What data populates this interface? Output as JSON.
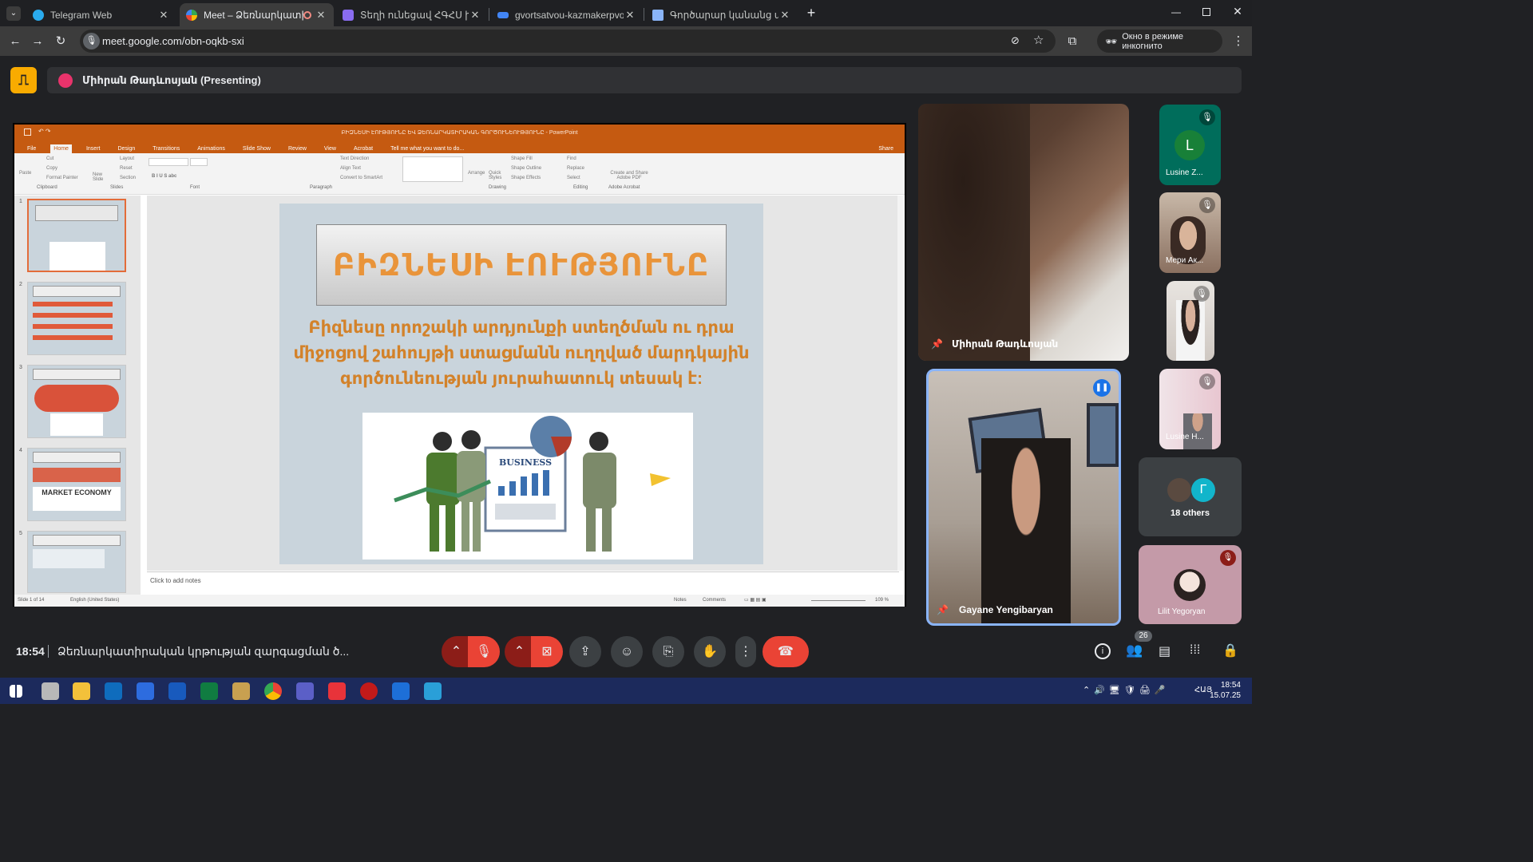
{
  "browser": {
    "tabs": [
      {
        "title": "Telegram Web",
        "favicon": "telegram-icon",
        "active": false
      },
      {
        "title": "Meet – Ձեռնարկատիրակ",
        "favicon": "meet-icon",
        "active": true,
        "recording": true
      },
      {
        "title": "Տեղի ունեցավ ՀԳՀՍ խորհրդ",
        "favicon": "proton-icon",
        "active": false
      },
      {
        "title": "gvortsatvou-kazmakerpvouthy",
        "favicon": "link-icon",
        "active": false
      },
      {
        "title": "Գործարար կանանց ակումբ",
        "favicon": "scissors-icon",
        "active": false
      }
    ],
    "url": "meet.google.com/obn-oqkb-sxi",
    "incognito_label": "Окно в режиме инкогнито"
  },
  "meet": {
    "presenting_label": "Միհրան Թադևոսյան (Presenting)",
    "time": "18:54",
    "meeting_title": "Ձեռնարկատիրական կրթության զարգացման ծ...",
    "people_count": "26"
  },
  "powerpoint": {
    "window_title": "ԲԻԶՆԵՍԻ ԷՈՒԹՅՈՒՆԸ ԵՎ ՁԵՌՆԱՐԿԱՏԻՐԱԿԱՆ ԳՈՐԾՈՒՆԵՈՒԹՅՈՒՆԸ - PowerPoint",
    "menus": [
      "File",
      "Home",
      "Insert",
      "Design",
      "Transitions",
      "Animations",
      "Slide Show",
      "Review",
      "View",
      "Acrobat"
    ],
    "tell_me": "Tell me what you want to do...",
    "share": "Share",
    "ribbon": {
      "clipboard": {
        "label": "Clipboard",
        "paste": "Paste",
        "cut": "Cut",
        "copy": "Copy",
        "format_painter": "Format Painter"
      },
      "slides": {
        "label": "Slides",
        "new_slide": "New Slide",
        "layout": "Layout",
        "reset": "Reset",
        "section": "Section"
      },
      "font": {
        "label": "Font"
      },
      "paragraph": {
        "label": "Paragraph",
        "text_direction": "Text Direction",
        "align_text": "Align Text",
        "convert": "Convert to SmartArt"
      },
      "drawing": {
        "label": "Drawing",
        "arrange": "Arrange",
        "quick_styles": "Quick Styles",
        "shape_fill": "Shape Fill",
        "shape_outline": "Shape Outline",
        "shape_effects": "Shape Effects"
      },
      "editing": {
        "label": "Editing",
        "find": "Find",
        "replace": "Replace",
        "select": "Select"
      },
      "acrobat": {
        "label": "Adobe Acrobat",
        "create": "Create and Share Adobe PDF"
      }
    },
    "thumbnails": [
      "1",
      "2",
      "3",
      "4",
      "5"
    ],
    "thumb4_caption": "MARKET ECONOMY",
    "slide": {
      "title": "ԲԻԶՆԵՍԻ ԷՈՒԹՅՈՒՆԸ",
      "body": "Բիզնեսը որոշակի արդյունքի ստեղծման ու դրա միջոցով շահույթի ստացմանն ուղղված մարդկային գործունեության յուրահատուկ տեսակ է:",
      "image_label": "BUSINESS"
    },
    "notes_placeholder": "Click to add notes",
    "status": {
      "slide": "Slide 1 of 14",
      "language": "English (United States)",
      "notes": "Notes",
      "comments": "Comments",
      "zoom": "109 %"
    }
  },
  "participants": {
    "main": [
      {
        "name": "Միհրան Թադևոսյան"
      },
      {
        "name": "Gayane Yengibaryan"
      }
    ],
    "side": [
      {
        "name": "Lusine Z...",
        "initial": "L",
        "color": "#188038"
      },
      {
        "name": "Мери Ак..."
      },
      {
        "name": ""
      },
      {
        "name": "Lusine H..."
      },
      {
        "name": "18 others",
        "initial": "Г",
        "color": "#12b5cb"
      },
      {
        "name": "Lilit Yegoryan"
      }
    ]
  },
  "taskbar": {
    "time": "18:54",
    "date": "15.07.25",
    "lang": "ՀԱՅ"
  }
}
